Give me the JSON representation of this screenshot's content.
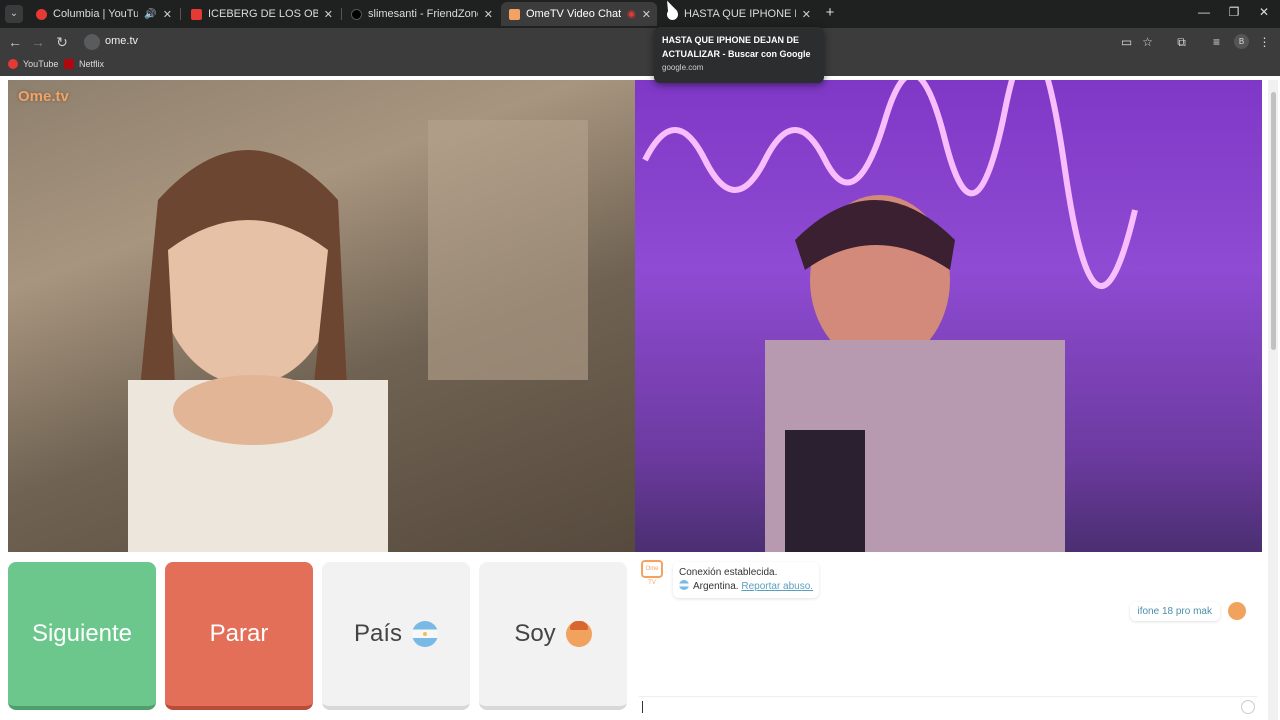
{
  "tabs": [
    {
      "title": "Columbia | YouTube Music",
      "indicator": "🔊"
    },
    {
      "title": "ICEBERG DE LOS OBJETOS PERDIDOS"
    },
    {
      "title": "slimesanti - FriendZone by slimesanti"
    },
    {
      "title": "OmeTV Video Chat — Omegle"
    },
    {
      "title": "HASTA QUE IPHONE DEJAN DE ACTUALIZAR"
    }
  ],
  "address_bar": {
    "url": "ome.tv"
  },
  "profile_initial": "B",
  "bookmarks": [
    {
      "label": "YouTube"
    },
    {
      "label": "Netflix"
    }
  ],
  "tooltip": {
    "title": "HASTA QUE IPHONE DEJAN DE ACTUALIZAR - Buscar con Google",
    "url": "google.com"
  },
  "logo_text": "Ome.tv",
  "buttons": {
    "next": "Siguiente",
    "stop": "Parar",
    "country": "País",
    "gender": "Soy"
  },
  "chat": {
    "logo": "Ome TV",
    "system_line1": "Conexión establecida.",
    "country_name": "Argentina.",
    "report_link": "Reportar abuso.",
    "user_message": "ifone 18 pro mak"
  },
  "colors": {
    "next": "#6bc78c",
    "stop": "#e46f59",
    "neutral": "#f2f2f2",
    "brand_orange": "#f4a262"
  }
}
